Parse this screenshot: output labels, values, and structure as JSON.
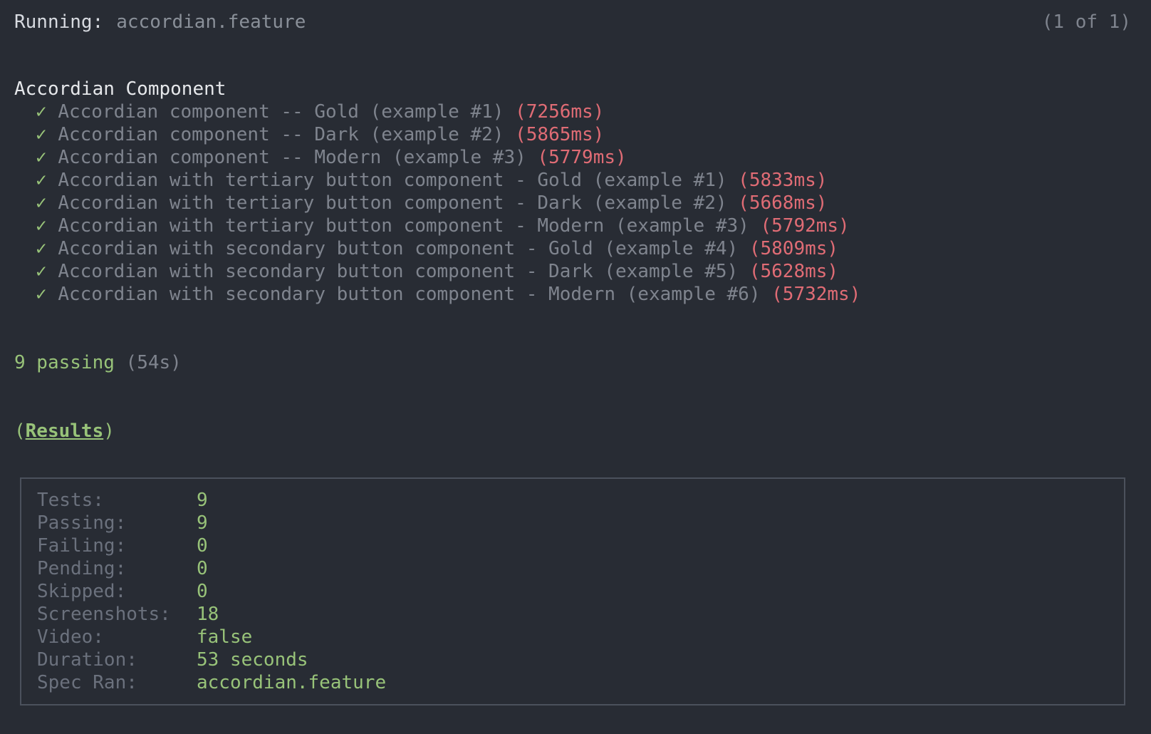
{
  "header": {
    "running_label": "Running:",
    "spec": "accordian.feature",
    "count": "(1 of 1)"
  },
  "suite": {
    "title": "Accordian Component",
    "check_glyph": "✓",
    "tests": [
      {
        "name": "Accordian component -- Gold (example #1)",
        "duration": "(7256ms)"
      },
      {
        "name": "Accordian component -- Dark (example #2)",
        "duration": "(5865ms)"
      },
      {
        "name": "Accordian component -- Modern (example #3)",
        "duration": "(5779ms)"
      },
      {
        "name": "Accordian with tertiary button component - Gold (example #1)",
        "duration": "(5833ms)"
      },
      {
        "name": "Accordian with tertiary button component - Dark (example #2)",
        "duration": "(5668ms)"
      },
      {
        "name": "Accordian with tertiary button component - Modern (example #3)",
        "duration": "(5792ms)"
      },
      {
        "name": "Accordian with secondary button component - Gold (example #4)",
        "duration": "(5809ms)"
      },
      {
        "name": "Accordian with secondary button component - Dark (example #5)",
        "duration": "(5628ms)"
      },
      {
        "name": "Accordian with secondary button component - Modern (example #6)",
        "duration": "(5732ms)"
      }
    ]
  },
  "summary": {
    "passing": "9 passing",
    "time": "(54s)"
  },
  "results": {
    "open": "(",
    "label": "Results",
    "close": ")"
  },
  "stats": [
    {
      "label": "Tests:",
      "value": "9"
    },
    {
      "label": "Passing:",
      "value": "9"
    },
    {
      "label": "Failing:",
      "value": "0"
    },
    {
      "label": "Pending:",
      "value": "0"
    },
    {
      "label": "Skipped:",
      "value": "0"
    },
    {
      "label": "Screenshots:",
      "value": "18"
    },
    {
      "label": "Video:",
      "value": "false"
    },
    {
      "label": "Duration:",
      "value": "53 seconds"
    },
    {
      "label": "Spec Ran:",
      "value": "accordian.feature"
    }
  ],
  "colors": {
    "background": "#282c34",
    "pass": "#98c379",
    "duration": "#e06c75",
    "muted": "#7f848e"
  }
}
